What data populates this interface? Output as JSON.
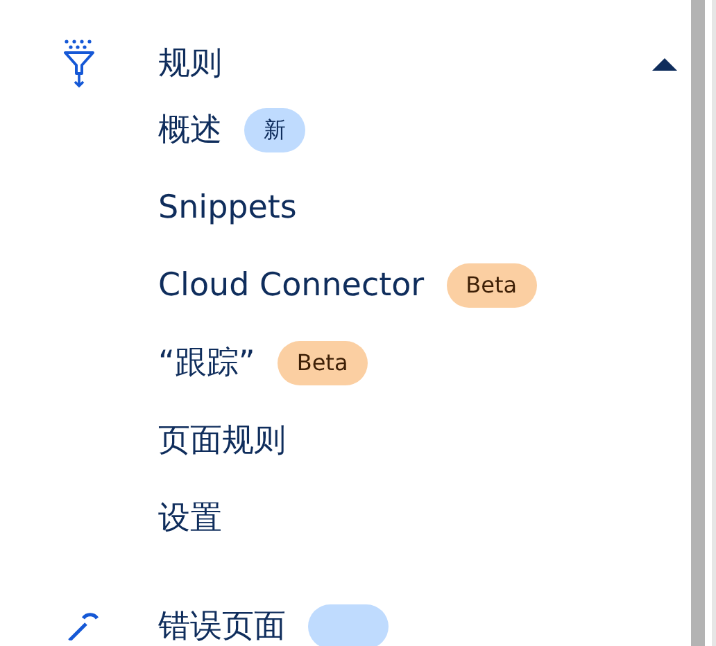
{
  "section": {
    "label": "规则",
    "expanded": true
  },
  "items": [
    {
      "label": "概述",
      "badge": {
        "text": "新",
        "kind": "new"
      }
    },
    {
      "label": "Snippets"
    },
    {
      "label": "Cloud Connector",
      "badge": {
        "text": "Beta",
        "kind": "beta"
      }
    },
    {
      "label": "“跟踪”",
      "badge": {
        "text": "Beta",
        "kind": "beta"
      }
    },
    {
      "label": "页面规则"
    },
    {
      "label": "设置"
    }
  ],
  "next_section": {
    "label": "错误页面",
    "badge": {
      "kind": "new"
    }
  }
}
